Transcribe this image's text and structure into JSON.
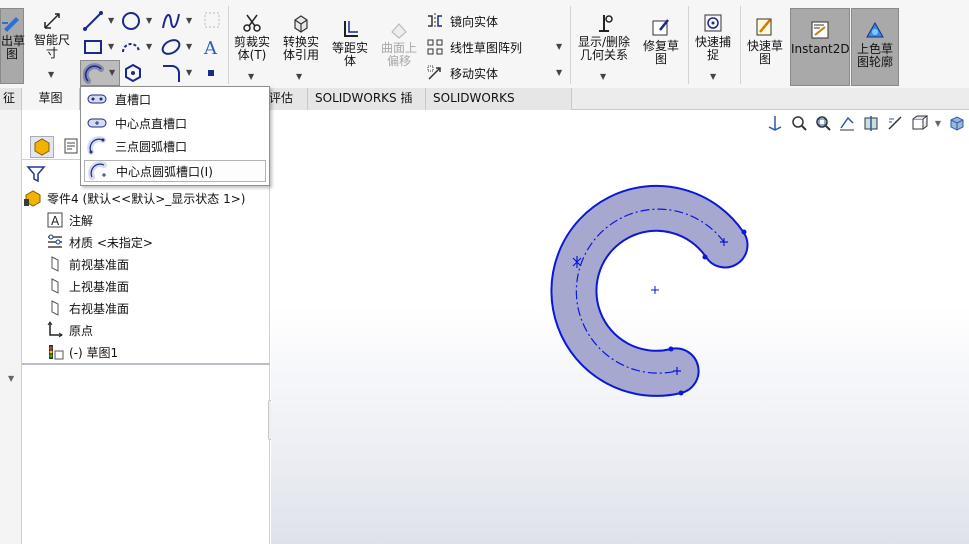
{
  "ribbon": {
    "exit_sketch": "出草\n图",
    "smart_dim": "智能尺\n寸",
    "trim": "剪裁实\n体(T)",
    "convert": "转换实\n体引用",
    "offset": "等距实\n体",
    "surface_offset": "曲面上\n偏移",
    "mirror": "镜向实体",
    "linear_pattern": "线性草图阵列",
    "move": "移动实体",
    "show_delete": "显示/删除\n几何关系",
    "repair": "修复草\n图",
    "quick_snap": "快速捕\n捉",
    "rapid_sketch": "快速草\n图",
    "instant2d": "Instant2D",
    "shaded_sketch": "上色草\n图轮廓"
  },
  "tabs": {
    "feature": "征",
    "sketch": "草图",
    "evaluate": "评估",
    "sw_addins": "SOLIDWORKS 插件",
    "sw_inspection": "SOLIDWORKS Inspection"
  },
  "slot_menu": {
    "items": [
      "直槽口",
      "中心点直槽口",
      "三点圆弧槽口",
      "中心点圆弧槽口(I)"
    ]
  },
  "tree": {
    "part": "零件4 (默认<<默认>_显示状态 1>)",
    "annotations": "注解",
    "material": "材质 <未指定>",
    "front_plane": "前视基准面",
    "top_plane": "上视基准面",
    "right_plane": "右视基准面",
    "origin": "原点",
    "sketch1": "(-) 草图1"
  },
  "colors": {
    "slot_fill": "#a6a8cf",
    "slot_stroke": "#0a18d8",
    "selection_bg": "#a9a9a9"
  }
}
